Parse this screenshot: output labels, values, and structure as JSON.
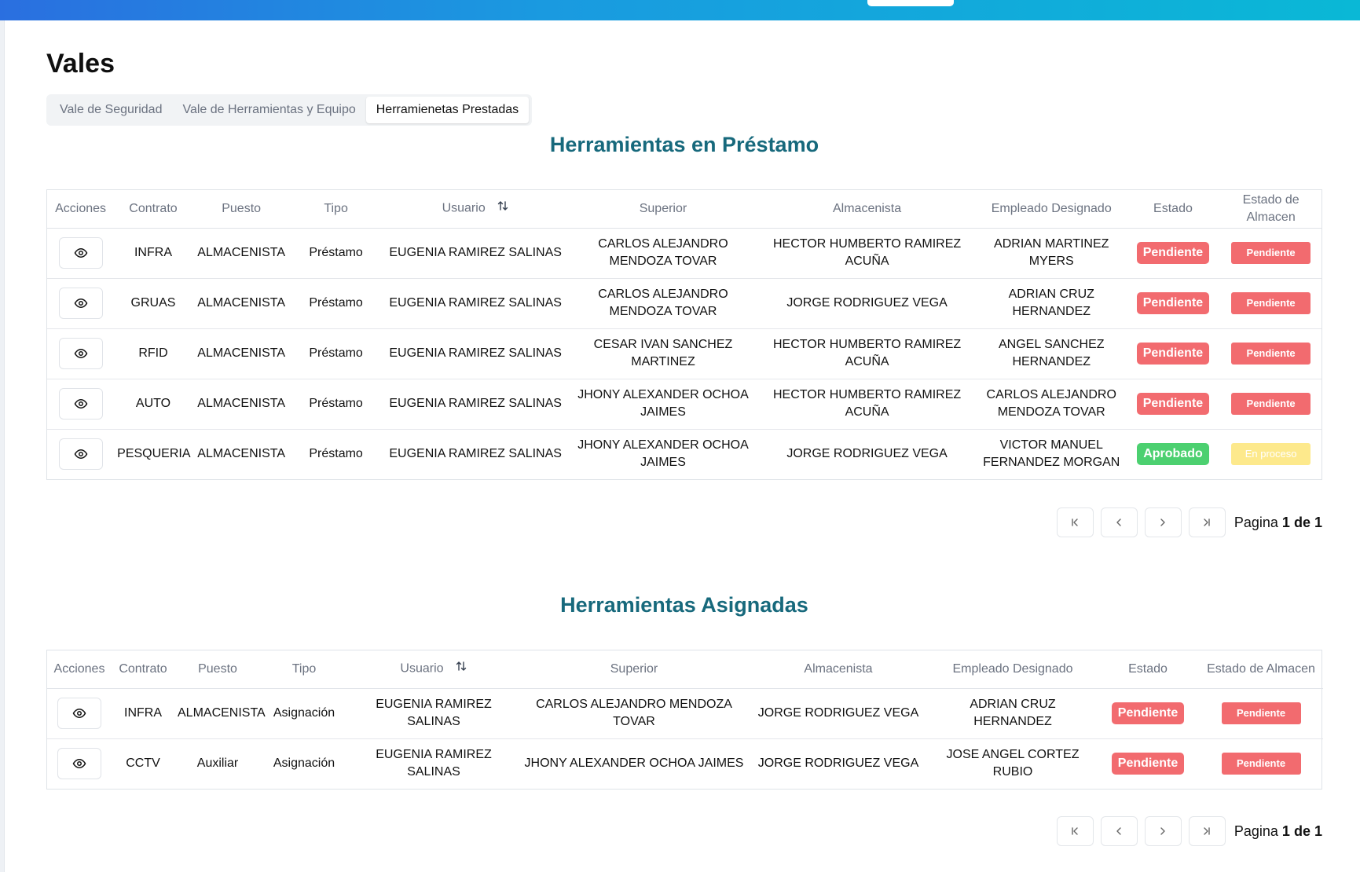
{
  "page": {
    "title": "Vales"
  },
  "tabs": [
    {
      "label": "Vale de Seguridad"
    },
    {
      "label": "Vale de Herramientas y Equipo"
    },
    {
      "label": "Herramienetas Prestadas"
    }
  ],
  "loans": {
    "title": "Herramientas en Préstamo",
    "columns": {
      "acciones": "Acciones",
      "contrato": "Contrato",
      "puesto": "Puesto",
      "tipo": "Tipo",
      "usuario": "Usuario",
      "superior": "Superior",
      "almacenista": "Almacenista",
      "empleado": "Empleado Designado",
      "estado": "Estado",
      "estado_almacen": "Estado de Almacen"
    },
    "rows": [
      {
        "contrato": "INFRA",
        "puesto": "ALMACENISTA",
        "tipo": "Préstamo",
        "usuario": "EUGENIA RAMIREZ SALINAS",
        "superior": "CARLOS ALEJANDRO MENDOZA TOVAR",
        "almacenista": "HECTOR HUMBERTO RAMIREZ ACUÑA",
        "empleado": "ADRIAN MARTINEZ MYERS",
        "estado": "Pendiente",
        "estado_almacen": "Pendiente"
      },
      {
        "contrato": "GRUAS",
        "puesto": "ALMACENISTA",
        "tipo": "Préstamo",
        "usuario": "EUGENIA RAMIREZ SALINAS",
        "superior": "CARLOS ALEJANDRO MENDOZA TOVAR",
        "almacenista": "JORGE RODRIGUEZ VEGA",
        "empleado": "ADRIAN CRUZ HERNANDEZ",
        "estado": "Pendiente",
        "estado_almacen": "Pendiente"
      },
      {
        "contrato": "RFID",
        "puesto": "ALMACENISTA",
        "tipo": "Préstamo",
        "usuario": "EUGENIA RAMIREZ SALINAS",
        "superior": "CESAR IVAN SANCHEZ MARTINEZ",
        "almacenista": "HECTOR HUMBERTO RAMIREZ ACUÑA",
        "empleado": "ANGEL SANCHEZ HERNANDEZ",
        "estado": "Pendiente",
        "estado_almacen": "Pendiente"
      },
      {
        "contrato": "AUTO",
        "puesto": "ALMACENISTA",
        "tipo": "Préstamo",
        "usuario": "EUGENIA RAMIREZ SALINAS",
        "superior": "JHONY ALEXANDER OCHOA JAIMES",
        "almacenista": "HECTOR HUMBERTO RAMIREZ ACUÑA",
        "empleado": "CARLOS ALEJANDRO MENDOZA TOVAR",
        "estado": "Pendiente",
        "estado_almacen": "Pendiente"
      },
      {
        "contrato": "PESQUERIA",
        "puesto": "ALMACENISTA",
        "tipo": "Préstamo",
        "usuario": "EUGENIA RAMIREZ SALINAS",
        "superior": "JHONY ALEXANDER OCHOA JAIMES",
        "almacenista": "JORGE RODRIGUEZ VEGA",
        "empleado": "VICTOR MANUEL FERNANDEZ MORGAN",
        "estado": "Aprobado",
        "estado_almacen": "En proceso"
      }
    ],
    "pager": {
      "prefix": "Pagina",
      "current": "1",
      "sep": "de",
      "total": "1"
    }
  },
  "assigned": {
    "title": "Herramientas Asignadas",
    "columns": {
      "acciones": "Acciones",
      "contrato": "Contrato",
      "puesto": "Puesto",
      "tipo": "Tipo",
      "usuario": "Usuario",
      "superior": "Superior",
      "almacenista": "Almacenista",
      "empleado": "Empleado Designado",
      "estado": "Estado",
      "estado_almacen": "Estado de Almacen"
    },
    "rows": [
      {
        "contrato": "INFRA",
        "puesto": "ALMACENISTA",
        "tipo": "Asignación",
        "usuario": "EUGENIA RAMIREZ SALINAS",
        "superior": "CARLOS ALEJANDRO MENDOZA TOVAR",
        "almacenista": "JORGE RODRIGUEZ VEGA",
        "empleado": "ADRIAN CRUZ HERNANDEZ",
        "estado": "Pendiente",
        "estado_almacen": "Pendiente"
      },
      {
        "contrato": "CCTV",
        "puesto": "Auxiliar",
        "tipo": "Asignación",
        "usuario": "EUGENIA RAMIREZ SALINAS",
        "superior": "JHONY ALEXANDER OCHOA JAIMES",
        "almacenista": "JORGE RODRIGUEZ VEGA",
        "empleado": "JOSE ANGEL CORTEZ RUBIO",
        "estado": "Pendiente",
        "estado_almacen": "Pendiente"
      }
    ],
    "pager": {
      "prefix": "Pagina",
      "current": "1",
      "sep": "de",
      "total": "1"
    }
  },
  "colors": {
    "accent": "#17697c",
    "pending": "#f26b6f",
    "approved": "#4cd070",
    "in_process": "#fde98c"
  }
}
